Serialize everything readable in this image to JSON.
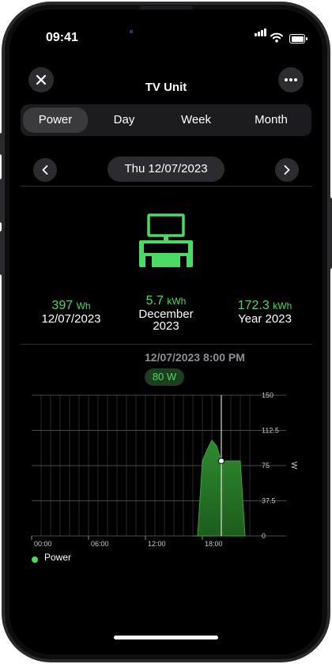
{
  "status": {
    "time": "09:41"
  },
  "header": {
    "title": "TV Unit"
  },
  "tabs": [
    {
      "label": "Power",
      "active": true
    },
    {
      "label": "Day",
      "active": false
    },
    {
      "label": "Week",
      "active": false
    },
    {
      "label": "Month",
      "active": false
    }
  ],
  "date_nav": {
    "date": "Thu 12/07/2023"
  },
  "stats": [
    {
      "value": "397",
      "unit": "Wh",
      "label": "12/07/2023"
    },
    {
      "value": "5.7",
      "unit": "kWh",
      "label_line1": "December",
      "label_line2": "2023"
    },
    {
      "value": "172.3",
      "unit": "kWh",
      "label": "Year 2023"
    }
  ],
  "selection": {
    "time": "12/07/2023 8:00 PM",
    "value": "80 W"
  },
  "colors": {
    "accent": "#4cd964",
    "accent_fill": "#2f8a2f",
    "background": "#000000"
  },
  "chart_data": {
    "type": "area",
    "series": [
      {
        "name": "Power",
        "x": [
          "17:00",
          "17:30",
          "18:00",
          "18:30",
          "19:00",
          "19:30",
          "20:00",
          "20:30",
          "21:00",
          "21:30",
          "22:00",
          "22:30"
        ],
        "values": [
          0,
          0,
          80,
          92,
          102,
          96,
          80,
          80,
          80,
          80,
          80,
          0
        ]
      }
    ],
    "x_ticks": [
      "00:00",
      "06:00",
      "12:00",
      "18:00"
    ],
    "y_ticks": [
      "150",
      "112.5",
      "75",
      "37.5",
      "0"
    ],
    "ylabel": "W",
    "ylim": [
      0,
      150
    ],
    "xlim_hours": [
      0,
      24
    ],
    "selected_x": "20:00",
    "legend": "Power"
  }
}
